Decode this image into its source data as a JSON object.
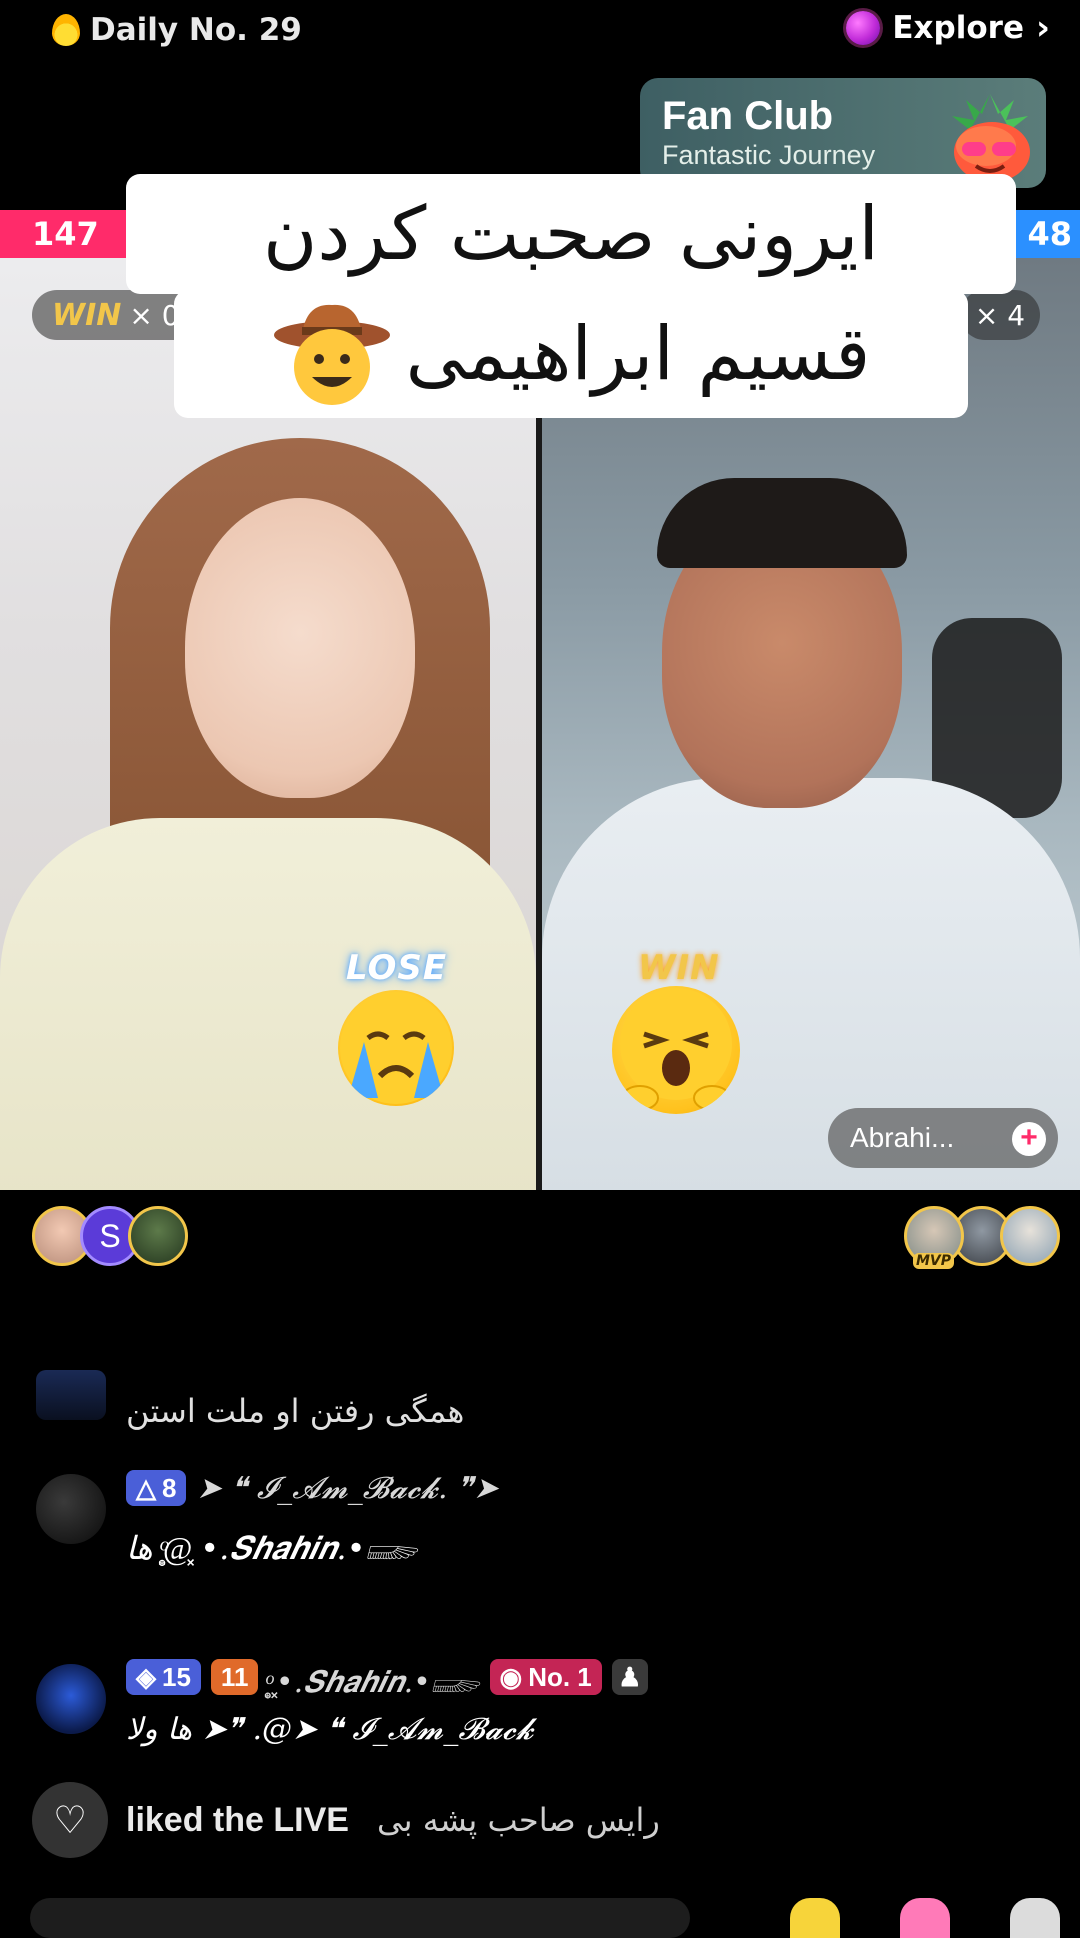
{
  "top": {
    "daily_label": "Daily No. 29",
    "explore_label": "Explore",
    "chevron": "›"
  },
  "fan_club": {
    "title": "Fan Club",
    "subtitle": "Fantastic Journey"
  },
  "battle": {
    "left_score": "147",
    "right_score": "48",
    "left_win_label": "WIN",
    "left_win_count": "× 0",
    "right_win_count": "× 4",
    "left_result": "LOSE",
    "right_result": "WIN",
    "left_color": "#ff2b6a",
    "right_color": "#2b90ff"
  },
  "caption": {
    "line1": "ایرونی صحبت کردن",
    "line2": "قسیم ابراهیمی"
  },
  "host": {
    "name": "Abrahi...",
    "follow": "+"
  },
  "avatars": {
    "left_letter": "S",
    "right_badge": "MVP"
  },
  "comments": [
    {
      "text": "همگی رفتن او ملت استن"
    },
    {
      "level": "8",
      "name": "➤ ❝ 𝓘_𝓐𝓶_𝓑𝓪𝓬𝓴. ❞➤",
      "text": "ها @̥͙ͦ ͓•.𝑺𝒉𝒂𝒉𝒊𝒏.•𓆃"
    },
    {
      "level": "15",
      "fan_level": "11",
      "name": "̥͙ͦ ͓•.𝑺𝒉𝒂𝒉𝒊𝒏.•𓆃",
      "rank": "No. 1",
      "text": "ها ولا ➤❞ .@➤ ❝ 𝓘_𝓐𝓶_𝓑𝓪𝓬𝓴"
    }
  ],
  "liked": {
    "action": "liked the LIVE",
    "user": "رایس صاحب پشه بی"
  }
}
